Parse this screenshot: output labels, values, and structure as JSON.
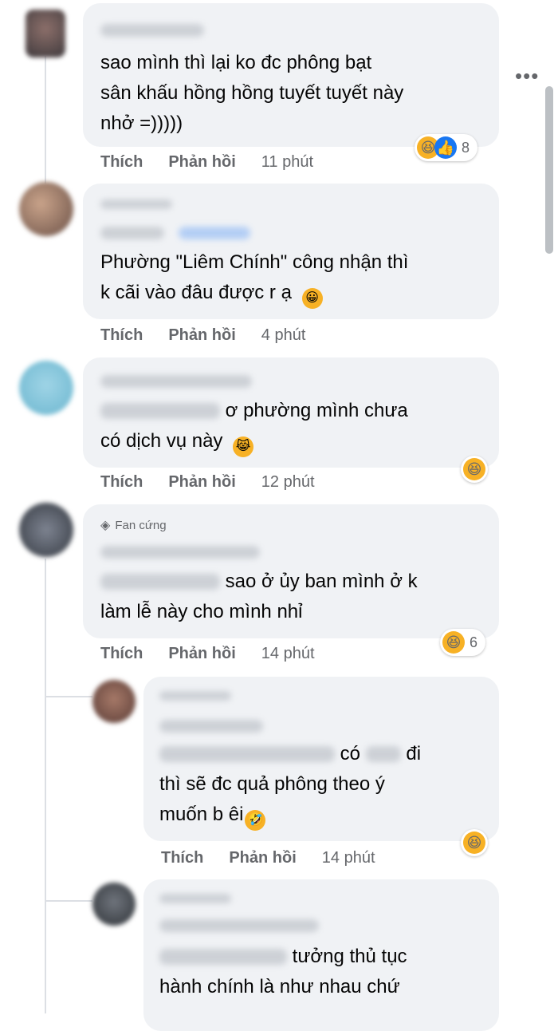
{
  "comments": [
    {
      "text_lines": [
        "sao mình thì lại ko đc phông bạt",
        "sân khấu hồng hồng tuyết tuyết này",
        "nhở =)))))"
      ],
      "like_label": "Thích",
      "reply_label": "Phản hồi",
      "time": "11 phút",
      "reactions": {
        "icons": [
          "haha-icon",
          "like-icon"
        ],
        "count": "8"
      }
    },
    {
      "text_lines": [
        "Phường \"Liêm Chính\" công nhận thì",
        "k cãi vào đâu được r ạ"
      ],
      "like_label": "Thích",
      "reply_label": "Phản hồi",
      "time": "4 phút"
    },
    {
      "text_lines": [
        "ơ phường mình chưa",
        "có dịch vụ này"
      ],
      "like_label": "Thích",
      "reply_label": "Phản hồi",
      "time": "12 phút",
      "reactions": {
        "icons": [
          "haha-icon"
        ]
      }
    },
    {
      "badge": "Fan cứng",
      "text_lines": [
        "sao ở ủy ban mình ở k",
        "làm lễ này cho mình nhỉ"
      ],
      "like_label": "Thích",
      "reply_label": "Phản hồi",
      "time": "14 phút",
      "reactions": {
        "icons": [
          "haha-icon"
        ],
        "count": "6"
      }
    }
  ],
  "replies": [
    {
      "text_lines": [
        "có",
        "đi",
        "thì sẽ đc quả phông theo ý",
        "muốn b êi"
      ],
      "like_label": "Thích",
      "reply_label": "Phản hồi",
      "time": "14 phút",
      "reactions": {
        "icons": [
          "haha-icon"
        ]
      }
    },
    {
      "text_lines": [
        "tưởng thủ tục",
        "hành chính là như nhau chứ"
      ]
    }
  ],
  "colors": {
    "bubble": "#f0f2f5",
    "action_text": "#65676b",
    "haha": "#f7b125",
    "like": "#1877f2"
  }
}
